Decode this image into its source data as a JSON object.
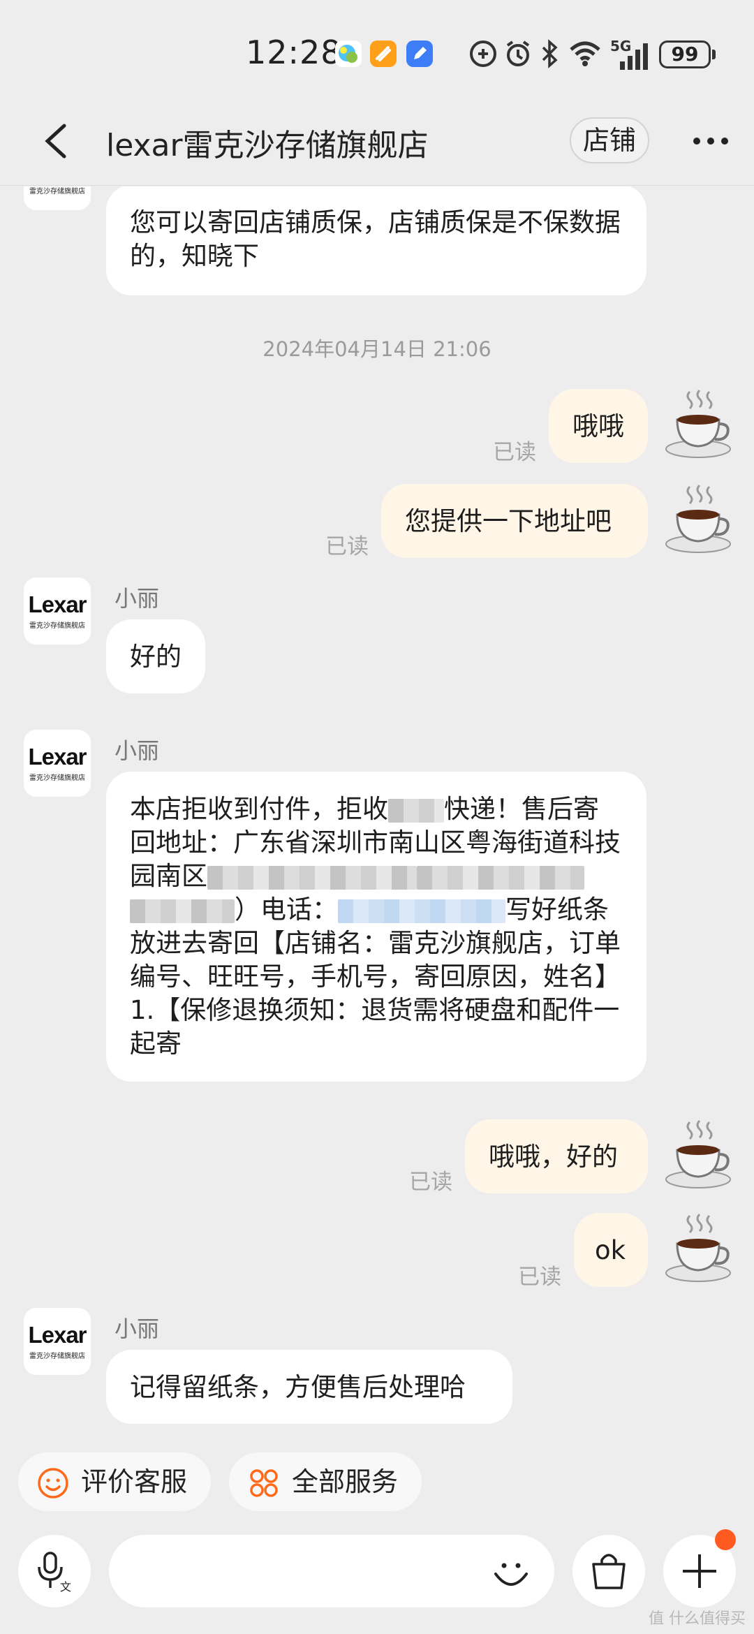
{
  "status_bar": {
    "time": "12:28",
    "network": "5G",
    "battery": "99"
  },
  "header": {
    "title": "lexar雷克沙存储旗舰店",
    "shop_button": "店铺"
  },
  "store_avatar": {
    "logo": "Lexar",
    "subtitle": "雷克沙存储旗舰店"
  },
  "messages": {
    "m0": {
      "text": "您可以寄回店铺质保，店铺质保是不保数据的，知晓下"
    },
    "timestamp": "2024年04月14日 21:06",
    "m1": {
      "text": "哦哦",
      "status": "已读"
    },
    "m2": {
      "text": "您提供一下地址吧",
      "status": "已读"
    },
    "m3": {
      "sender": "小丽",
      "text": "好的"
    },
    "m4": {
      "sender": "小丽",
      "part1": "本店拒收到付件，拒收",
      "part2": "快递！售后寄回地址：广东省深圳市南山区粤海街道科技园南区",
      "part3": "）电话：",
      "part4": "写好纸条放进去寄回【店铺名：雷克沙旗舰店，订单编号、旺旺号，手机号，寄回原因，姓名】1.【保修退换须知：退货需将硬盘和配件一起寄"
    },
    "m5": {
      "text": "哦哦，好的",
      "status": "已读"
    },
    "m6": {
      "text": "ok",
      "status": "已读"
    },
    "m7": {
      "sender": "小丽",
      "text": "记得留纸条，方便售后处理哈"
    }
  },
  "quick_actions": {
    "rate": "评价客服",
    "all_services": "全部服务"
  },
  "input": {
    "placeholder": ""
  },
  "watermark": "值 什么值得买",
  "colors": {
    "accent": "#ff6a1a",
    "my_bubble": "#fff6e7",
    "background": "#ededed"
  }
}
